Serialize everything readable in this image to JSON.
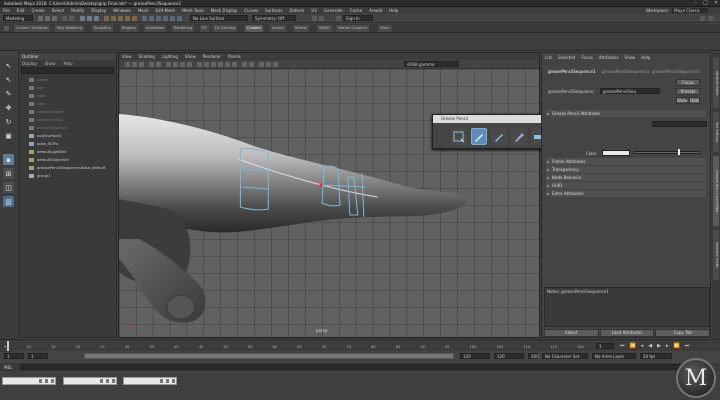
{
  "window": {
    "title": "Autodesk Maya 2018: C:\\Users\\Admin\\Desktop\\grip Final.mb*  ---  greasePencilSequence1",
    "controls": [
      "–",
      "□",
      "✕"
    ]
  },
  "menubar": {
    "items": [
      "File",
      "Edit",
      "Create",
      "Select",
      "Modify",
      "Display",
      "Windows",
      "Mesh",
      "Edit Mesh",
      "Mesh Tools",
      "Mesh Display",
      "Curves",
      "Surfaces",
      "Deform",
      "UV",
      "Generate",
      "Cache",
      "Arnold",
      "Help"
    ],
    "workspace_label": "Workspace:",
    "workspace_value": "Maya Classic"
  },
  "statusline": {
    "mode": "Modeling",
    "no_live": "No Live Surface",
    "symmetry": "Symmetry: Off",
    "sign_in": "Sign In"
  },
  "shelf": {
    "tabs": [
      "Curves / Surfaces",
      "Poly Modeling",
      "Sculpting",
      "Rigging",
      "Animation",
      "Rendering",
      "FX",
      "FX Caching",
      "Custom",
      "Arnold",
      "Bifrost",
      "MASH",
      "Motion Graphics",
      "XGen"
    ],
    "active_index": 8
  },
  "outliner": {
    "title": "Outliner",
    "menus": [
      "Display",
      "Show",
      "Help"
    ],
    "items": [
      {
        "label": "persp",
        "dim": true
      },
      {
        "label": "top",
        "dim": true
      },
      {
        "label": "front",
        "dim": true
      },
      {
        "label": "side",
        "dim": true
      },
      {
        "label": "Loreleyn:Base",
        "dim": true
      },
      {
        "label": "Loreleyn:Grip",
        "dim": true
      },
      {
        "label": "pencilSequence",
        "dim": true
      },
      {
        "label": "polySurface1",
        "dim": false
      },
      {
        "label": "pose_IK3Fo",
        "dim": false
      },
      {
        "label": "defaultLightSet",
        "dim": false
      },
      {
        "label": "defaultObjectSet",
        "dim": false
      },
      {
        "label": "greasePencilSequence.Base_default",
        "dim": false
      },
      {
        "label": "group1",
        "dim": false
      }
    ]
  },
  "viewport": {
    "menus": [
      "View",
      "Shading",
      "Lighting",
      "Show",
      "Renderer",
      "Panels"
    ],
    "colorspace": "sRGB gamma",
    "camera_label": "persp",
    "axis_label": "x  y"
  },
  "palette": {
    "title": "Grease Pencil",
    "tools": [
      "marquee-icon",
      "pencil-icon",
      "brush-icon",
      "marker-icon",
      "stroke-width-icon",
      "eraser-icon",
      "ghost-prev-icon",
      "ghost-next-icon",
      "import-icon",
      "export-icon",
      "help-icon"
    ],
    "accent": "#5d8bbd"
  },
  "attribute_editor": {
    "menus": [
      "List",
      "Selected",
      "Focus",
      "Attributes",
      "Show",
      "Help"
    ],
    "tab_name": "greasePencilSequence1",
    "tab_secondary": "greasePencilSequence1",
    "node_label": "greasePencilSequence:",
    "node_value": "greasePencilSeq",
    "buttons": [
      "Focus",
      "Presets",
      "Show",
      "Hide"
    ],
    "section_main": "Grease Pencil Attributes",
    "sections": [
      "Frame Attributes",
      "Transparency",
      "Node Behavior",
      "UUID",
      "Extra Attributes"
    ],
    "color_label": "Color",
    "notes_label": "Notes: greasePencilSequence1",
    "bottom_buttons": [
      "Select",
      "Load Attributes",
      "Copy Tab"
    ]
  },
  "sidetabs": [
    "Attribute Editor",
    "Tool Settings",
    "Channel Box / Layer Editor",
    "Modeling Toolkit"
  ],
  "timeslider": {
    "ticks": [
      "5",
      "10",
      "15",
      "20",
      "25",
      "30",
      "35",
      "40",
      "45",
      "50",
      "55",
      "60",
      "65",
      "70",
      "75",
      "80",
      "85",
      "90",
      "95",
      "100",
      "105",
      "110",
      "115",
      "120"
    ],
    "current_frame": "1"
  },
  "range": {
    "start": "1",
    "start_inner": "1",
    "end_inner": "120",
    "end": "120",
    "end_outer": "200",
    "character_set": "No Character Set",
    "anim_layer": "No Anim Layer",
    "fps": "24 fps"
  },
  "cmdline": {
    "label": "MEL"
  },
  "mini_windows": [
    "Untitled",
    "Untitled",
    "Untitled"
  ],
  "logo": "M"
}
